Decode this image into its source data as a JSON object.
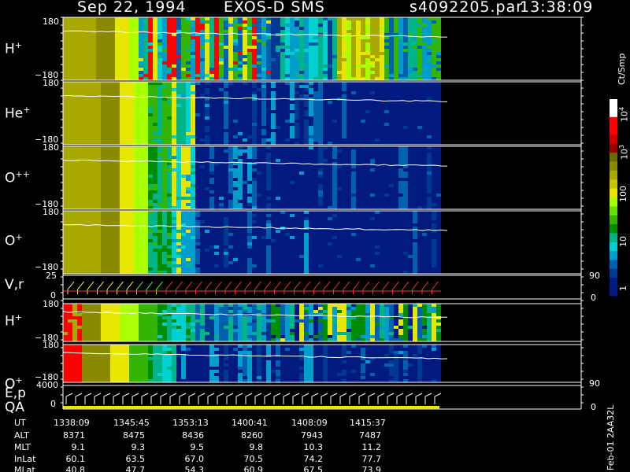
{
  "title": {
    "date": "Sep 22, 1994",
    "mission": "EXOS-D SMS",
    "file": "s4092205.par",
    "time": "13:38:09"
  },
  "panels": [
    {
      "label_main": "H",
      "label_sup": "+",
      "ytop": "180",
      "ybot": "−180"
    },
    {
      "label_main": "He",
      "label_sup": "+",
      "ytop": "180",
      "ybot": "−180"
    },
    {
      "label_main": "O",
      "label_sup": "++",
      "ytop": "180",
      "ybot": "−180"
    },
    {
      "label_main": "O",
      "label_sup": "+",
      "ytop": "180",
      "ybot": "−180"
    },
    {
      "label_main": "V,r",
      "label_sup": "",
      "ytop": "25",
      "ybot": "0",
      "rtop": "90",
      "rbot": "0"
    },
    {
      "label_main": "H",
      "label_sup": "+",
      "ytop": "180",
      "ybot": "−180"
    },
    {
      "label_main": "O",
      "label_sup": "+",
      "ytop": "180",
      "ybot": "−180"
    },
    {
      "label_main": "E,p",
      "label2": "QA",
      "label_sup": "",
      "ytop": "4000",
      "ybot": "0",
      "rtop": "90",
      "rbot": "0"
    }
  ],
  "colorbar": {
    "unit": "Ct/Smp",
    "ticks": [
      {
        "base": "10",
        "exp": "4"
      },
      {
        "base": "10",
        "exp": "3"
      },
      {
        "base": "100",
        "exp": ""
      },
      {
        "base": "10",
        "exp": ""
      },
      {
        "base": "1",
        "exp": ""
      }
    ],
    "colors": [
      "#ffffff",
      "#ffffff",
      "#ff0000",
      "#ff0000",
      "#cc0000",
      "#990000",
      "#6b6b00",
      "#8a8a00",
      "#a8a800",
      "#c6c600",
      "#e6e600",
      "#aaff00",
      "#66e000",
      "#33b400",
      "#008c00",
      "#00b488",
      "#00d0d0",
      "#009ccc",
      "#0060b0",
      "#003890",
      "#001a80",
      "#001a80"
    ]
  },
  "ephemeris": {
    "labels": [
      "UT",
      "ALT",
      "MLT",
      "InLat",
      "MLat"
    ],
    "ut": [
      "1338:09",
      "1345:45",
      "1353:13",
      "1400:41",
      "1408:09",
      "1415:37"
    ],
    "alt": [
      "8371",
      "8475",
      "8436",
      "8260",
      "7943",
      "7487"
    ],
    "mlt": [
      "9.1",
      "9.3",
      "9.5",
      "9.8",
      "10.3",
      "11.2"
    ],
    "inlat": [
      "60.1",
      "63.5",
      "67.0",
      "70.5",
      "74.2",
      "77.7"
    ],
    "mlat": [
      "40.8",
      "47.7",
      "54.3",
      "60.9",
      "67.5",
      "73.9"
    ]
  },
  "footer_id": "Feb-01 2AA32L",
  "chart_data": {
    "type": "heatmap",
    "title": "Sep 22, 1994   EXOS-D SMS   s4092205.par  13:38:09",
    "xlabel": "UT",
    "x_ticks": [
      "1338:09",
      "1345:45",
      "1353:13",
      "1400:41",
      "1408:09",
      "1415:37"
    ],
    "panels": [
      "H+",
      "He+",
      "O++",
      "O+",
      "V,r",
      "H+",
      "O+",
      "E,p QA"
    ],
    "ylim_angle": [
      -180,
      180
    ],
    "ylim_vr": [
      0,
      25
    ],
    "ylim_ep": [
      0,
      4000
    ],
    "colorbar_label": "Ct/Smp",
    "colorbar_log_range": [
      1,
      10000
    ]
  }
}
